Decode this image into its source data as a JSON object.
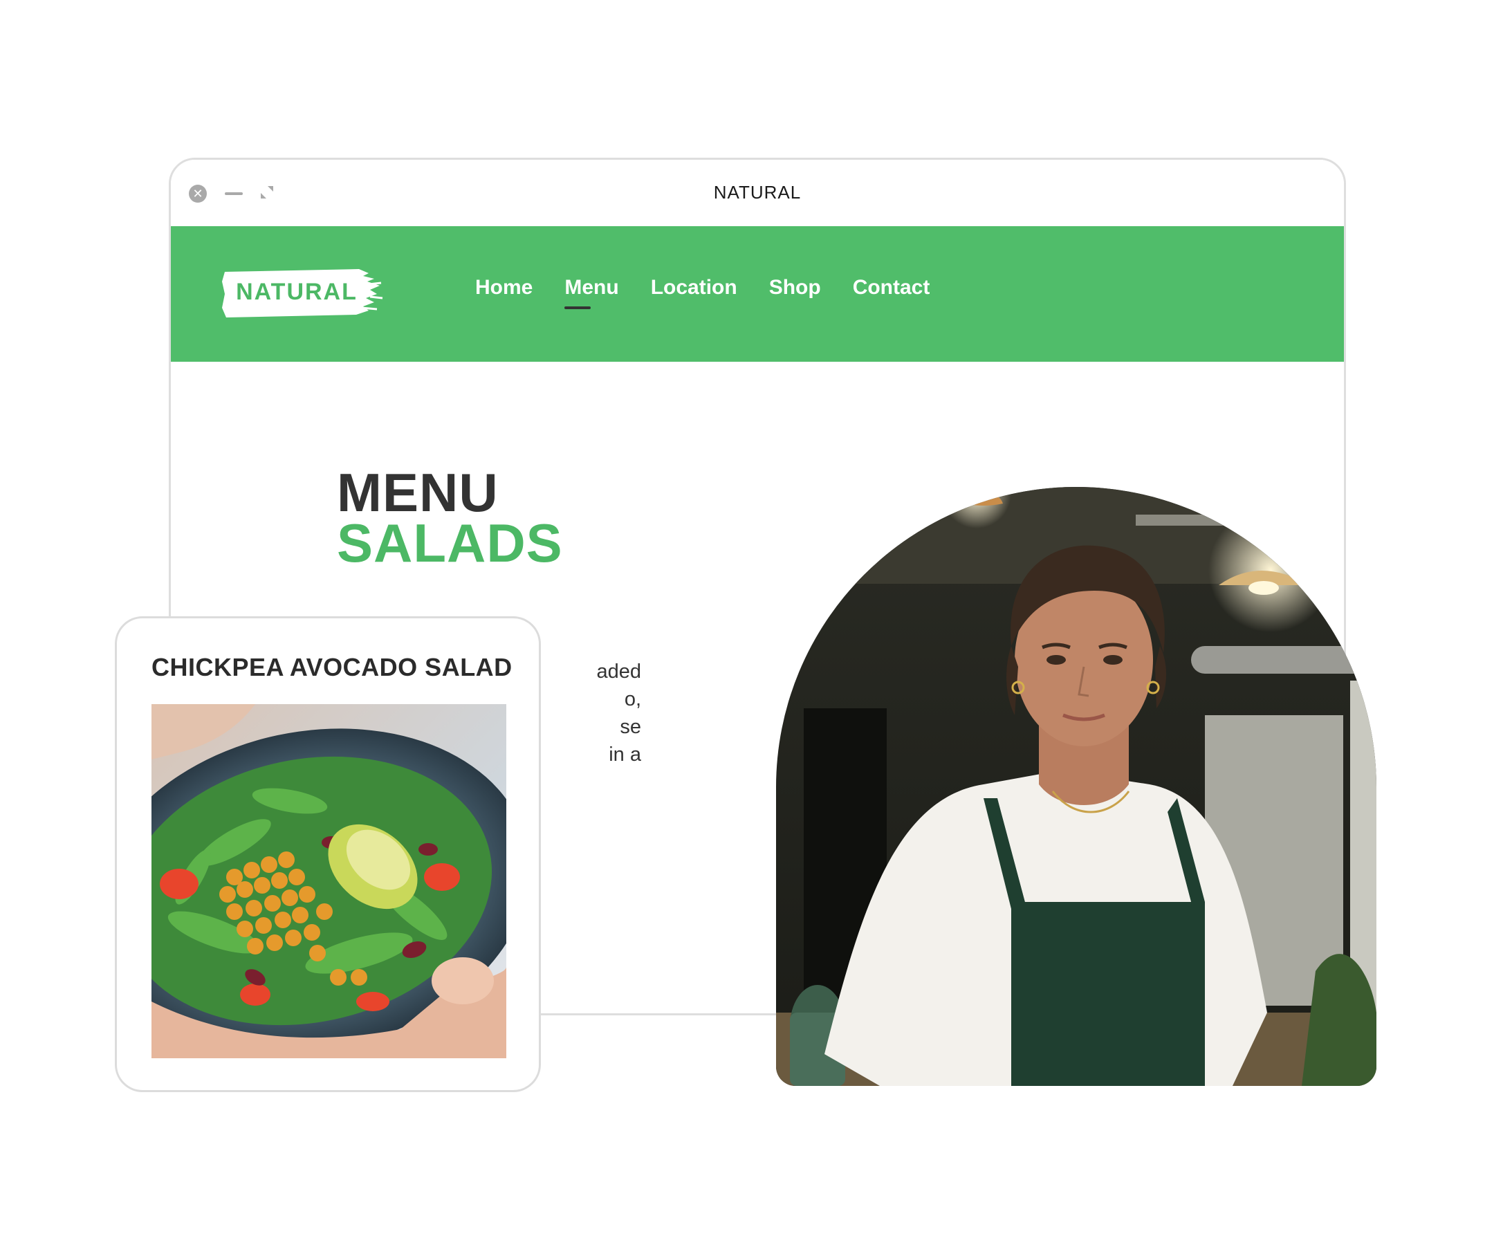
{
  "window": {
    "title": "NATURAL",
    "controls": [
      "close-icon",
      "minimize-icon",
      "expand-icon"
    ]
  },
  "brand": {
    "logo_text": "NATURAL",
    "accent_color": "#50bd6a"
  },
  "nav": {
    "items": [
      {
        "label": "Home",
        "active": false
      },
      {
        "label": "Menu",
        "active": true
      },
      {
        "label": "Location",
        "active": false
      },
      {
        "label": "Shop",
        "active": false
      },
      {
        "label": "Contact",
        "active": false
      }
    ]
  },
  "hero": {
    "line1": "MENU",
    "line2": "SALADS"
  },
  "description": {
    "lines": [
      "aded",
      "o,",
      "se",
      "in a"
    ]
  },
  "card": {
    "title": "CHICKPEA AVOCADO SALAD"
  }
}
